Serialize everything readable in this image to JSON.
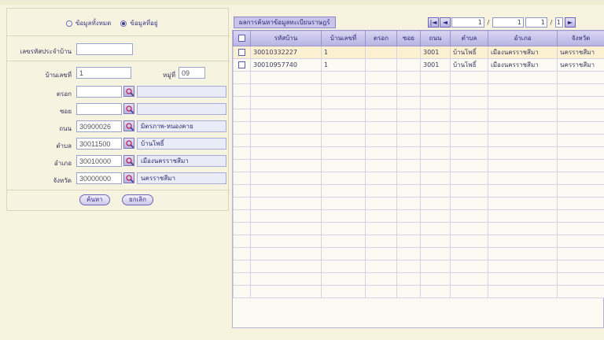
{
  "filter": {
    "radio_options": [
      {
        "label": "ข้อมูลทั้งหมด",
        "selected": false
      },
      {
        "label": "ข้อมูลที่อยู่",
        "selected": true
      }
    ],
    "house_code_label": "เลขรหัสประจำบ้าน",
    "house_code_value": "",
    "house_no_label": "บ้านเลขที่",
    "house_no_value": "1",
    "moo_label": "หมู่ที่",
    "moo_value": "09",
    "trok_label": "ตรอก",
    "trok_code": "",
    "trok_name": "",
    "soi_label": "ซอย",
    "soi_code": "",
    "soi_name": "",
    "road_label": "ถนน",
    "road_code": "30900026",
    "road_name": "มิตรภาพ-หนองคาย",
    "tambon_label": "ตำบล",
    "tambon_code": "30011500",
    "tambon_name": "บ้านโพธิ์",
    "amphoe_label": "อำเภอ",
    "amphoe_code": "30010000",
    "amphoe_name": "เมืองนครราชสีมา",
    "province_label": "จังหวัด",
    "province_code": "30000000",
    "province_name": "นครราชสีมา",
    "search_button": "ค้นหา",
    "clear_button": "ยกเลิก"
  },
  "grid": {
    "title": "ผลการค้นหาข้อมูลทะเบียนราษฎร์",
    "pager": {
      "first": "|◄",
      "prev": "◄",
      "next": "►",
      "last": "►|",
      "page_from": "1",
      "page_to": "1",
      "total_pages": "1",
      "per_page": "1"
    },
    "columns": [
      "รหัสบ้าน",
      "บ้านเลขที่",
      "ตรอก",
      "ซอย",
      "ถนน",
      "ตำบล",
      "อำเภอ",
      "จังหวัด"
    ],
    "rows": [
      {
        "house_code": "30010332227",
        "house_no": "1",
        "trok": "",
        "soi": "",
        "road": "3001",
        "tambon": "บ้านโพธิ์",
        "amphoe": "เมืองนครราชสีมา",
        "province": "นครราชสีมา",
        "selected": true
      },
      {
        "house_code": "30010957740",
        "house_no": "1",
        "trok": "",
        "soi": "",
        "road": "3001",
        "tambon": "บ้านโพธิ์",
        "amphoe": "เมืองนครราชสีมา",
        "province": "นครราชสีมา",
        "selected": false
      }
    ],
    "empty_rows": 18
  },
  "colors": {
    "background": "#f7f3df",
    "header": "#c9c4ea",
    "selected_row": "#fbf0cf",
    "accent": "#3b2f8a"
  }
}
